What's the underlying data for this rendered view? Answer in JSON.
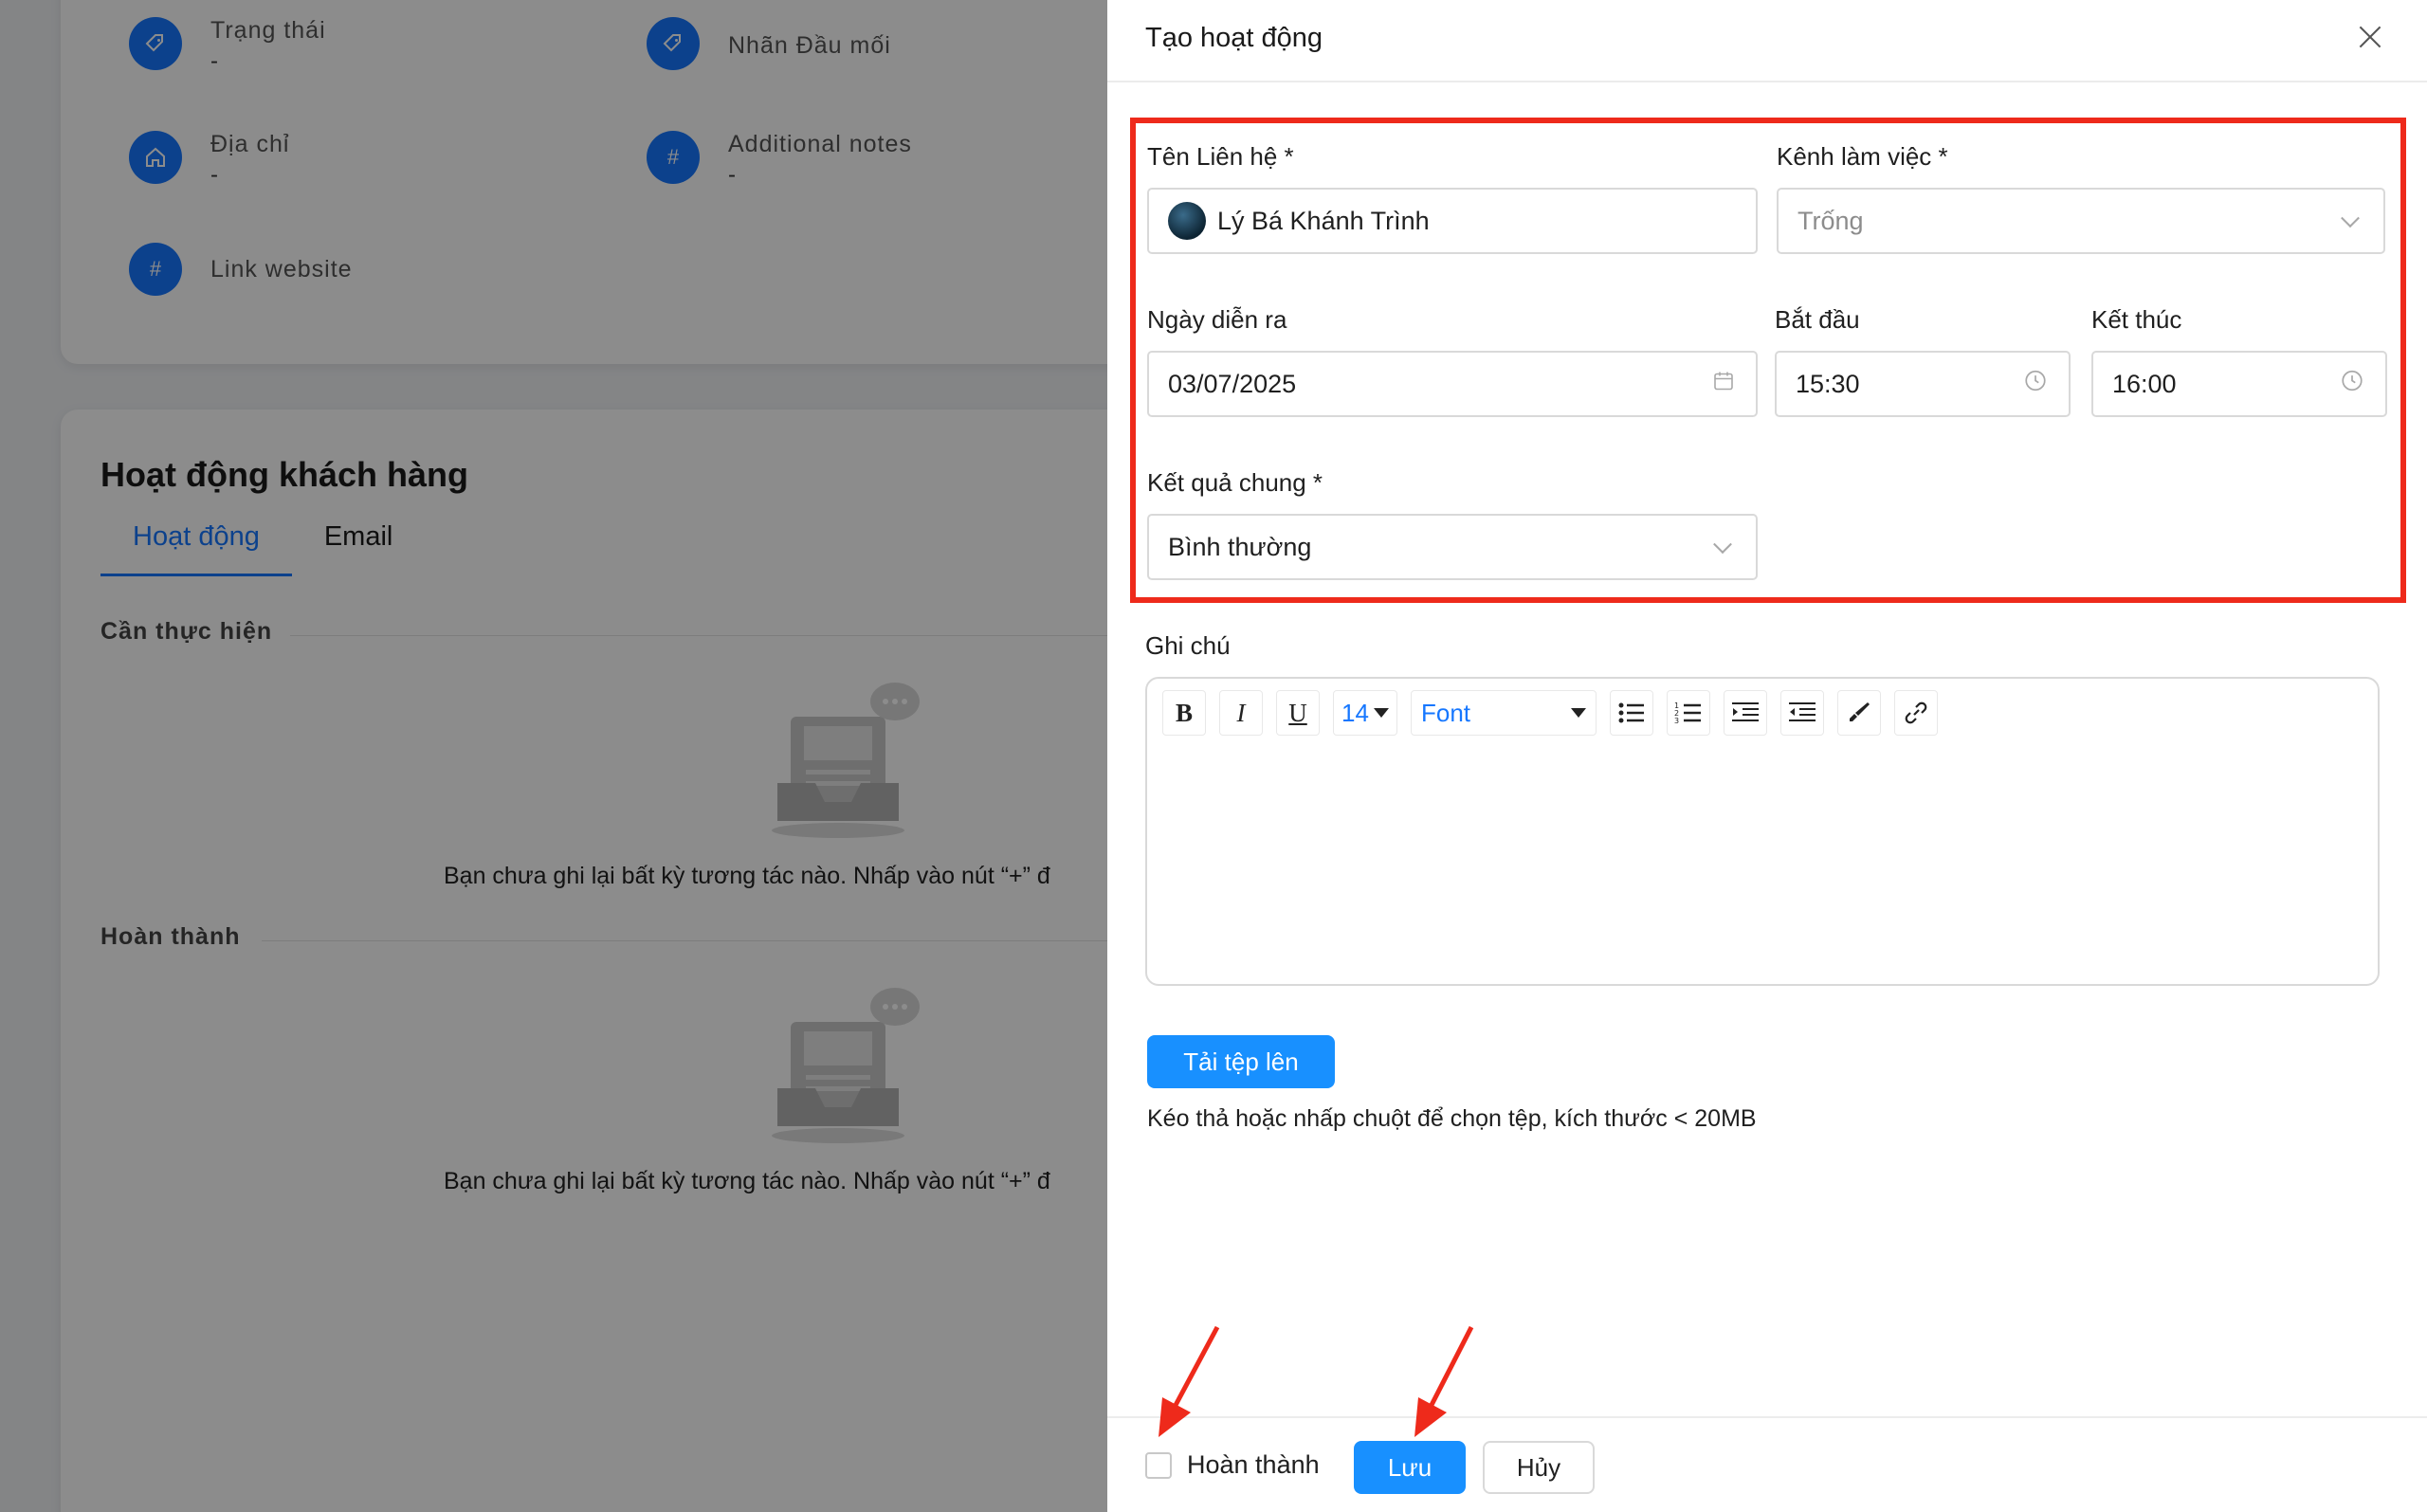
{
  "background": {
    "info": {
      "status_label": "Trạng thái",
      "status_value": "-",
      "lead_tag_label": "Nhãn Đầu mối",
      "address_label": "Địa chỉ",
      "address_value": "-",
      "notes_label": "Additional notes",
      "notes_value": "-",
      "website_label": "Link website"
    },
    "activity": {
      "title": "Hoạt động khách hàng",
      "tabs": [
        {
          "label": "Hoạt động",
          "active": true
        },
        {
          "label": "Email",
          "active": false
        }
      ],
      "todo_label": "Cần thực hiện",
      "done_label": "Hoàn thành",
      "empty_text": "Bạn chưa ghi lại bất kỳ tương tác nào. Nhấp vào nút “+” đ"
    }
  },
  "drawer": {
    "title": "Tạo hoạt động",
    "contact": {
      "label": "Tên Liên hệ *",
      "value": "Lý Bá Khánh Trình"
    },
    "channel": {
      "label": "Kênh làm việc *",
      "value": "Trống"
    },
    "date": {
      "label": "Ngày diễn ra",
      "value": "03/07/2025"
    },
    "start": {
      "label": "Bắt đầu",
      "value": "15:30"
    },
    "end": {
      "label": "Kết thúc",
      "value": "16:00"
    },
    "result": {
      "label": "Kết quả chung *",
      "value": "Bình thường"
    },
    "note": {
      "label": "Ghi chú",
      "toolbar": {
        "bold": "B",
        "italic": "I",
        "underline": "U",
        "size": "14",
        "font": "Font"
      }
    },
    "upload": {
      "button": "Tải tệp lên",
      "hint": "Kéo thả hoặc nhấp chuột để chọn tệp, kích thước < 20MB"
    },
    "footer": {
      "done_label": "Hoàn thành",
      "save": "Lưu",
      "cancel": "Hủy"
    }
  },
  "colors": {
    "accent": "#1890ff",
    "highlight": "#ee2a1b",
    "overlay": "rgba(0,0,0,0.45)"
  }
}
